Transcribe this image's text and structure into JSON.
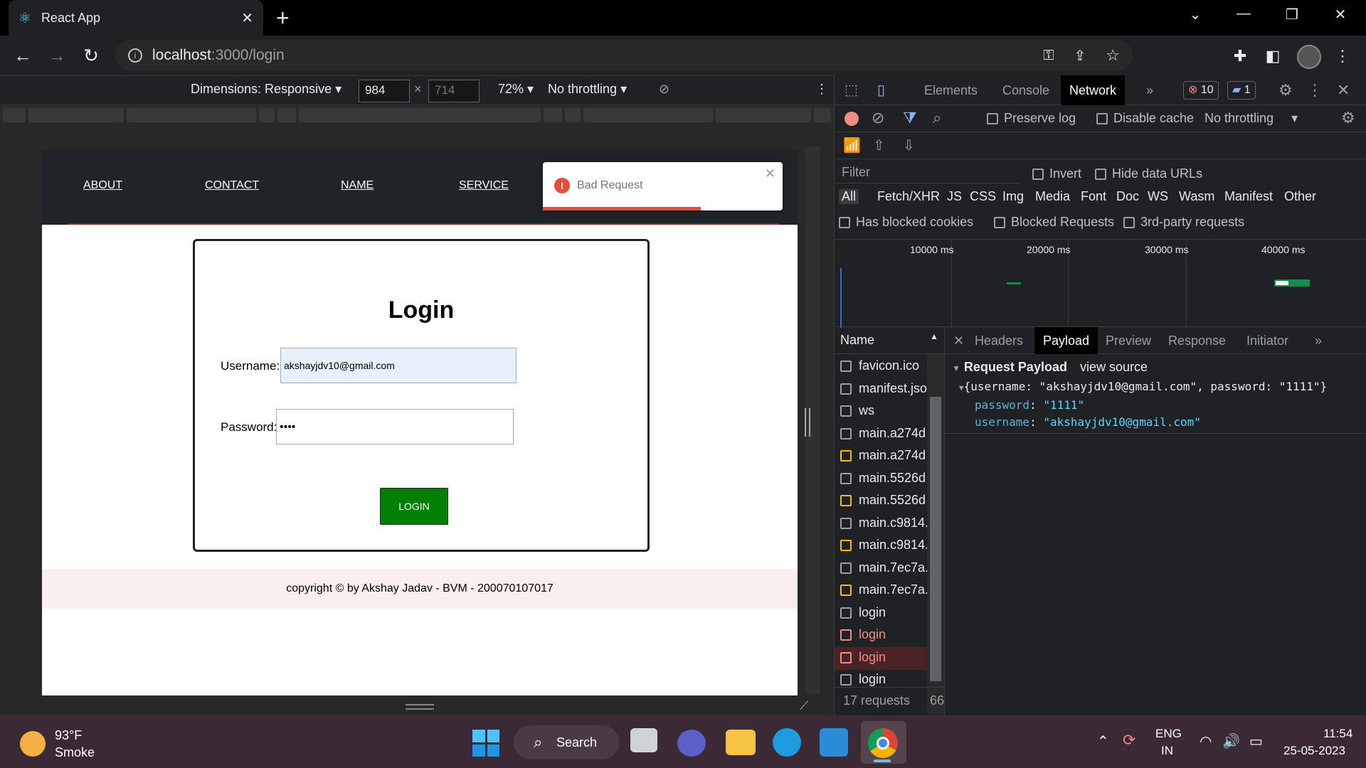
{
  "browser": {
    "tab_title": "React App",
    "url_host": "localhost",
    "url_path": ":3000/login"
  },
  "device_toolbar": {
    "dimensions_label": "Dimensions: Responsive",
    "width": "984",
    "height": "714",
    "zoom": "72%",
    "throttling": "No throttling"
  },
  "page": {
    "nav": [
      "ABOUT",
      "CONTACT",
      "NAME",
      "SERVICE"
    ],
    "toast": {
      "message": "Bad Request",
      "progress": 0.66
    },
    "login_title": "Login",
    "username_label": "Username:",
    "username_value": "akshayjdv10@gmail.com",
    "password_label": "Password:",
    "password_value": "••••",
    "login_button": "LOGIN",
    "footer": "copyright © by Akshay Jadav - BVM - 200070107017"
  },
  "devtools": {
    "tabs": [
      "Elements",
      "Console",
      "Network"
    ],
    "active_tab": "Network",
    "more": "»",
    "error_count": "10",
    "message_count": "1",
    "preserve_log": "Preserve log",
    "disable_cache": "Disable cache",
    "throttling": "No throttling",
    "filter_placeholder": "Filter",
    "invert": "Invert",
    "hide_data_urls": "Hide data URLs",
    "types": [
      "All",
      "Fetch/XHR",
      "JS",
      "CSS",
      "Img",
      "Media",
      "Font",
      "Doc",
      "WS",
      "Wasm",
      "Manifest",
      "Other"
    ],
    "has_blocked_cookies": "Has blocked cookies",
    "blocked_requests": "Blocked Requests",
    "third_party": "3rd-party requests",
    "timeline_marks": [
      "10000 ms",
      "20000 ms",
      "30000 ms",
      "40000 ms"
    ],
    "name_header": "Name",
    "requests": [
      {
        "name": "favicon.ico",
        "kind": "doc"
      },
      {
        "name": "manifest.json",
        "kind": "doc"
      },
      {
        "name": "ws",
        "kind": "doc"
      },
      {
        "name": "main.a274d",
        "kind": "doc"
      },
      {
        "name": "main.a274d",
        "kind": "js"
      },
      {
        "name": "main.5526d",
        "kind": "doc"
      },
      {
        "name": "main.5526d",
        "kind": "js"
      },
      {
        "name": "main.c9814.",
        "kind": "doc"
      },
      {
        "name": "main.c9814.",
        "kind": "js"
      },
      {
        "name": "main.7ec7a.",
        "kind": "doc"
      },
      {
        "name": "main.7ec7a.",
        "kind": "js"
      },
      {
        "name": "login",
        "kind": "doc"
      },
      {
        "name": "login",
        "kind": "err"
      },
      {
        "name": "login",
        "kind": "errsel"
      },
      {
        "name": "login",
        "kind": "doc"
      }
    ],
    "request_count": "17 requests",
    "transfer_partial": "66",
    "detail_tabs": [
      "Headers",
      "Payload",
      "Preview",
      "Response",
      "Initiator"
    ],
    "active_detail": "Payload",
    "request_payload": "Request Payload",
    "view_source": "view source",
    "payload_summary": "{username: \"akshayjdv10@gmail.com\", password: \"1111\"}",
    "payload_password_key": "password",
    "payload_password_val": "\"1111\"",
    "payload_username_key": "username",
    "payload_username_val": "\"akshayjdv10@gmail.com\""
  },
  "taskbar": {
    "temperature": "93°F",
    "condition": "Smoke",
    "search": "Search",
    "lang1": "ENG",
    "lang2": "IN",
    "time": "11:54",
    "date": "25-05-2023"
  },
  "colors": {
    "toast_error": "#e74c3c",
    "login_button": "#008000",
    "devtools_bg": "#202124",
    "request_error": "#f28b82"
  }
}
